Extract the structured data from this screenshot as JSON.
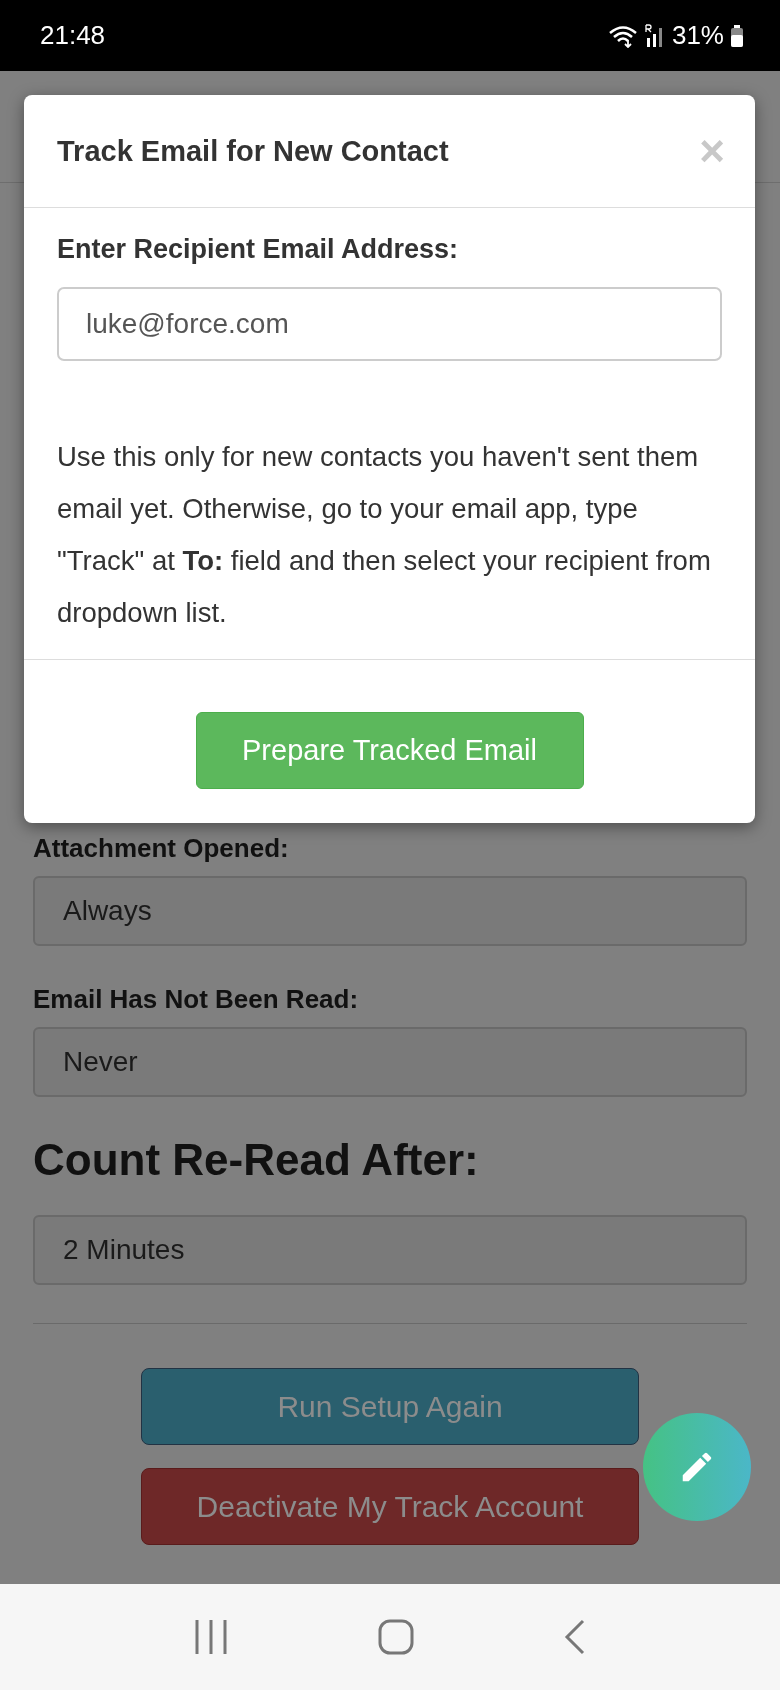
{
  "status_bar": {
    "time": "21:48",
    "battery": "31%"
  },
  "modal": {
    "title": "Track Email for New Contact",
    "close": "×",
    "label": "Enter Recipient Email Address:",
    "email": "luke@force.com",
    "note": "Use this only for new contacts you haven't sent them email yet. Otherwise, go to your email app, type \"Track\" at **To:** field and then select your recipient from dropdown list.",
    "button": "Prepare Tracked Email"
  },
  "page": {
    "fields": [
      {
        "label": "Attachment Opened:",
        "value": "Always"
      },
      {
        "label": "Email Has Not Been Read:",
        "value": "Never"
      }
    ],
    "heading": "Count Re-Read After:",
    "reread_value": "2 Minutes",
    "buttons": [
      {
        "label": "Run Setup Again",
        "kind": "primary"
      },
      {
        "label": "Deactivate My Track Account",
        "kind": "danger"
      }
    ]
  }
}
